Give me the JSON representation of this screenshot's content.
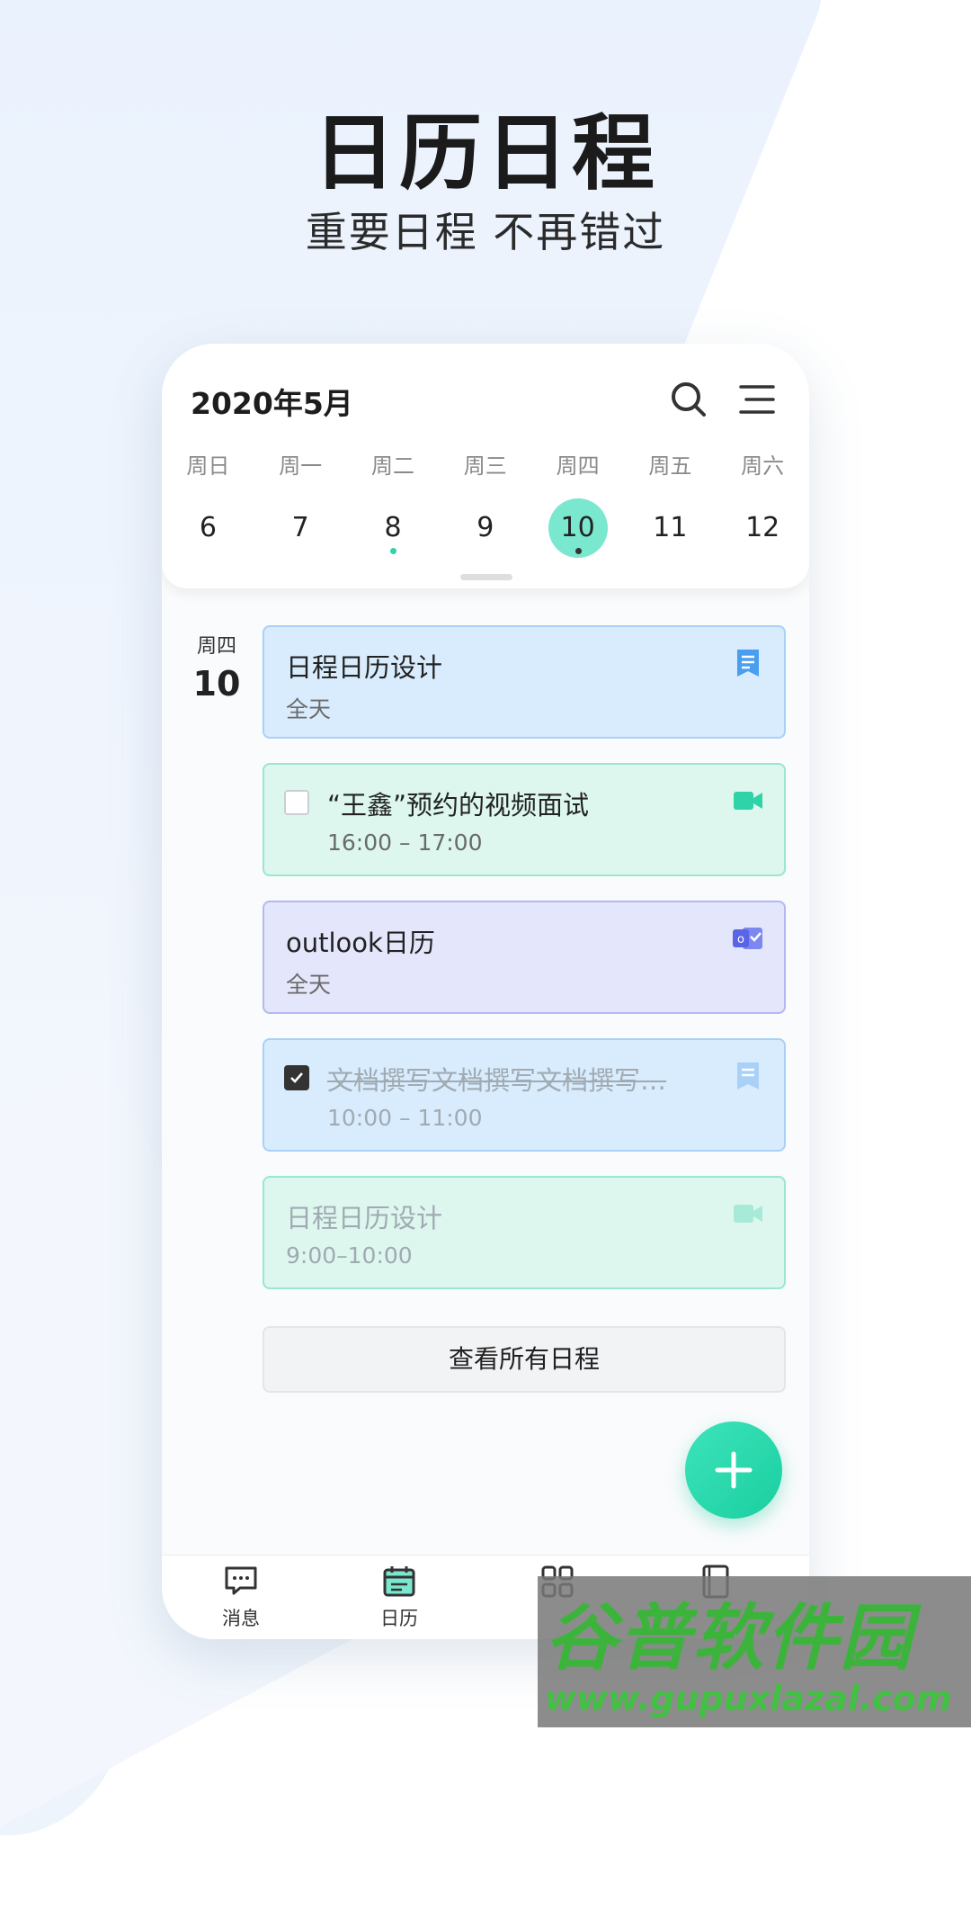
{
  "hero": {
    "title": "日历日程",
    "subtitle": "重要日程 不再错过"
  },
  "calendar": {
    "month_label": "2020年5月",
    "weekdays": [
      "周日",
      "周一",
      "周二",
      "周三",
      "周四",
      "周五",
      "周六"
    ],
    "days": [
      "6",
      "7",
      "8",
      "9",
      "10",
      "11",
      "12"
    ],
    "selected_day": "10",
    "accent_color": "#7ae7cf"
  },
  "list": {
    "date_weekday": "周四",
    "date_day": "10",
    "events": [
      {
        "title": "日程日历设计",
        "time": "全天",
        "color": "blue",
        "icon": "document-icon",
        "checkbox": "none"
      },
      {
        "title": "“王鑫”预约的视频面试",
        "time": "16:00 – 17:00",
        "color": "green",
        "icon": "video-camera-icon",
        "checkbox": "unchecked"
      },
      {
        "title": "outlook日历",
        "time": "全天",
        "color": "purple",
        "icon": "outlook-icon",
        "checkbox": "none"
      },
      {
        "title": "文档撰写文档撰写文档撰写…",
        "time": "10:00 – 11:00",
        "color": "blue",
        "icon": "document-icon",
        "checkbox": "checked",
        "completed": true
      },
      {
        "title": "日程日历设计",
        "time": "9:00–10:00",
        "color": "green",
        "icon": "video-camera-icon",
        "checkbox": "none",
        "past": true
      }
    ],
    "view_all_label": "查看所有日程"
  },
  "tabbar": {
    "tabs": [
      {
        "label": "消息",
        "icon": "message-icon"
      },
      {
        "label": "日历",
        "icon": "calendar-icon",
        "active": true
      },
      {
        "label": "",
        "icon": "apps-grid-icon"
      },
      {
        "label": "",
        "icon": "contacts-book-icon"
      }
    ]
  },
  "watermark": {
    "brand": "谷普软件园",
    "url": "www.gupuxlazal.com"
  }
}
